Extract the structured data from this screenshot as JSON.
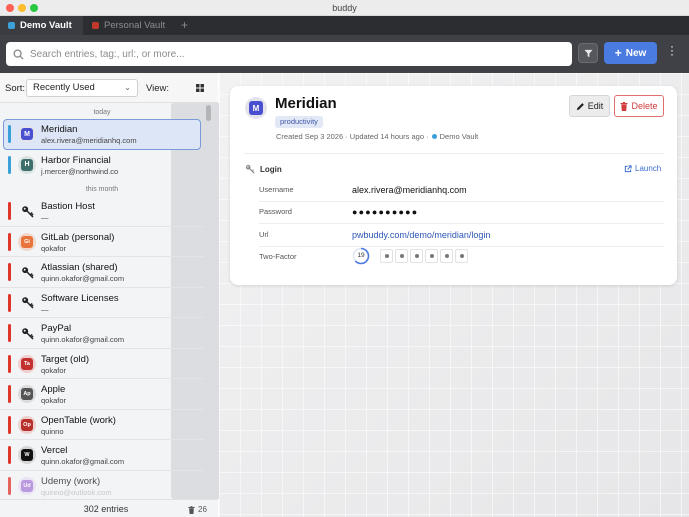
{
  "window": {
    "title": "buddy"
  },
  "tabs": [
    {
      "label": "Demo Vault",
      "color": "#3aa0d8",
      "active": true
    },
    {
      "label": "Personal Vault",
      "color": "#c0392b",
      "active": false
    }
  ],
  "tab_add": "+",
  "toolbar": {
    "search_placeholder": "Search entries, tag:, url:, or more...",
    "new_label": "New"
  },
  "sidebar": {
    "sort_label": "Sort:",
    "sort_value": "Recently Used",
    "view_label": "View:",
    "groups": [
      {
        "label": "today"
      },
      {
        "label": "this month"
      }
    ],
    "entries": [
      {
        "name": "Meridian",
        "sub": "alex.rivera@meridianhq.com",
        "bar": "#3aa0d8",
        "icon": "M",
        "icon_bg": "#4a4fd0",
        "selected": true
      },
      {
        "name": "Harbor Financial",
        "sub": "j.mercer@northwind.co",
        "bar": "#3aa0d8",
        "icon": "H",
        "icon_bg": "#3f6f6a"
      },
      {
        "name": "Bastion Host",
        "sub": "—",
        "bar": "#e0352b",
        "icon": "key-icon"
      },
      {
        "name": "GitLab (personal)",
        "sub": "qokafor",
        "bar": "#e0352b",
        "icon": "Gi",
        "icon_bg": "#e8743b"
      },
      {
        "name": "Atlassian (shared)",
        "sub": "quinn.okafor@gmail.com",
        "bar": "#e0352b",
        "icon": "key-icon"
      },
      {
        "name": "Software Licenses",
        "sub": "—",
        "bar": "#e0352b",
        "icon": "key-icon"
      },
      {
        "name": "PayPal",
        "sub": "quinn.okafor@gmail.com",
        "bar": "#e0352b",
        "icon": "key-icon"
      },
      {
        "name": "Target (old)",
        "sub": "qokafor",
        "bar": "#e0352b",
        "icon": "Ta",
        "icon_bg": "#c23030"
      },
      {
        "name": "Apple",
        "sub": "qokafor",
        "bar": "#e0352b",
        "icon": "Ap",
        "icon_bg": "#555555"
      },
      {
        "name": "OpenTable (work)",
        "sub": "quinno",
        "bar": "#e0352b",
        "icon": "Op",
        "icon_bg": "#b8302b"
      },
      {
        "name": "Vercel",
        "sub": "quinn.okafor@gmail.com",
        "bar": "#e0352b",
        "icon": "W",
        "icon_bg": "#111111"
      },
      {
        "name": "Udemy (work)",
        "sub": "quinno@outlook.com",
        "bar": "#e0352b",
        "icon": "Ud",
        "icon_bg": "#a87bd8"
      }
    ],
    "footer_count": "302 entries",
    "trash_count": "26"
  },
  "detail": {
    "avatar": "M",
    "title": "Meridian",
    "tag": "productivity",
    "meta_created": "Created Sep 3 2026 · Updated 14 hours ago ·",
    "meta_vault": "Demo Vault",
    "edit_label": "Edit",
    "delete_label": "Delete",
    "section_label": "Login",
    "launch_label": "Launch",
    "fields": [
      {
        "label": "Username",
        "value": "alex.rivera@meridianhq.com"
      },
      {
        "label": "Password",
        "value": "●●●●●●●●●●"
      },
      {
        "label": "Url",
        "value": "pwbuddy.com/demo/meridian/login"
      },
      {
        "label": "Two-Factor",
        "otp_seconds": "19",
        "otp_progress": 0.63
      }
    ]
  }
}
